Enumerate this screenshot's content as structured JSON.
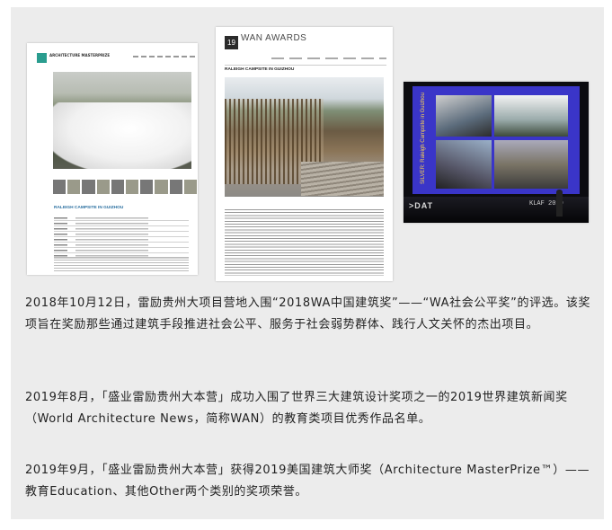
{
  "shot1": {
    "logo_text": "ARCHITECTURE MASTERPRIZE",
    "heading": "RALEIGH CAMPSITE IN GUIZHOU"
  },
  "shot2": {
    "badge": "19",
    "brand": "WAN AWARDS",
    "title": "RALEIGH CAMPSITE IN GUIZHOU"
  },
  "shot3": {
    "screen_title": "SILVER: Raleigh Campsite in Guizhou",
    "stage_left": ">DAT",
    "stage_right": "KLAF 2019"
  },
  "paragraphs": [
    "2018年10月12日，雷励贵州大项目营地入围“2018WA中国建筑奖”——“WA社会公平奖”的评选。该奖项旨在奖励那些通过建筑手段推进社会公平、服务于社会弱势群体、践行人文关怀的杰出项目。",
    "2019年8月，「盛业雷励贵州大本营」成功入围了世界三大建筑设计奖项之一的2019世界建筑新闻奖（World Architecture News，简称WAN）的教育类项目优秀作品名单。",
    "2019年9月，「盛业雷励贵州大本营」获得2019美国建筑大师奖（Architecture MasterPrize™）——教育Education、其他Other两个类别的奖项荣誉。"
  ]
}
